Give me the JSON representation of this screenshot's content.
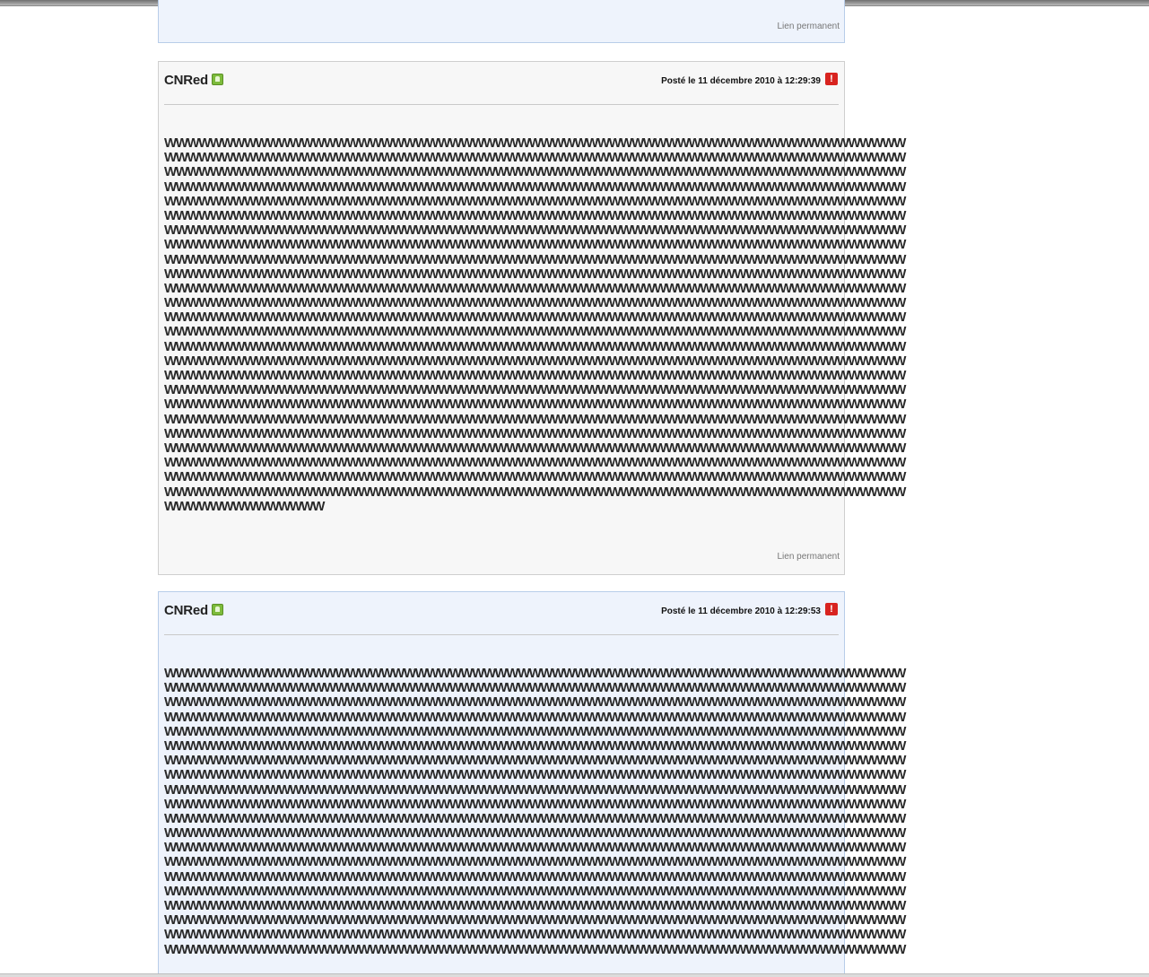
{
  "post0": {
    "permalink": "Lien permanent"
  },
  "post1": {
    "author": "CNRed",
    "date": "Posté le 11 décembre 2010 à 12:29:39",
    "permalink": "Lien permanent",
    "line_full": "WWWWWWWWWWWWWWWWWWWWWWWWWWWWWWWWWWWWWWWWWWWWWWWWWWWWWWWWWWWWWWWWW",
    "line_last": "WWWWWWWWWWWWWW"
  },
  "post2": {
    "author": "CNRed",
    "date": "Posté le 11 décembre 2010 à 12:29:53",
    "line_full": "WWWWWWWWWWWWWWWWWWWWWWWWWWWWWWWWWWWWWWWWWWWWWWWWWWWWWWWWWWWWWWWWW"
  },
  "icons": {
    "online": "online-status-icon",
    "report": "report-icon"
  },
  "colors": {
    "post_gray_bg": "#f7f7f7",
    "post_blue_bg": "#eef3fc",
    "post_blue_border": "#b8cde9",
    "report_red": "#d8231f",
    "online_green": "#7dbb3c"
  }
}
